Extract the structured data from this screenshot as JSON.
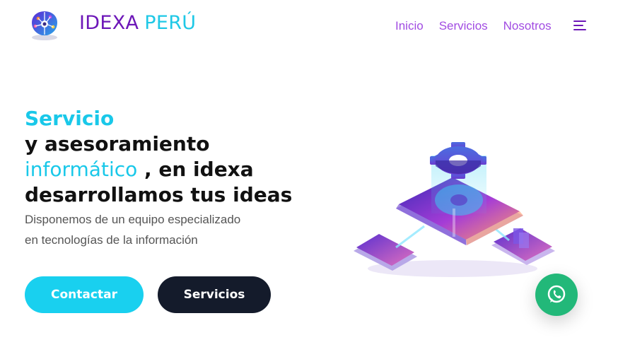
{
  "brand": {
    "name_part1": "IDEXA",
    "name_part2": "PERÚ"
  },
  "nav": {
    "items": [
      "Inicio",
      "Servicios",
      "Nosotros"
    ]
  },
  "hero": {
    "line1": "Servicio",
    "line2": "y asesoramiento",
    "line3_highlight": "informático",
    "line3_rest": " , en idexa",
    "line4": "desarrollamos tus ideas",
    "description_line1": "Disponemos de un equipo especializado",
    "description_line2": "en tecnologías de la información"
  },
  "buttons": {
    "contact": "Contactar",
    "services": "Servicios"
  },
  "icons": {
    "logo": "brain-circuit-logo",
    "menu": "menu-icon",
    "whatsapp": "whatsapp-icon",
    "hero": "isometric-gear-platform-illustration"
  },
  "colors": {
    "primary_purple": "#6d17b8",
    "nav_purple": "#a14be2",
    "cyan": "#19c8e9",
    "dark_button": "#141b2b",
    "whatsapp_green": "#22b879"
  }
}
